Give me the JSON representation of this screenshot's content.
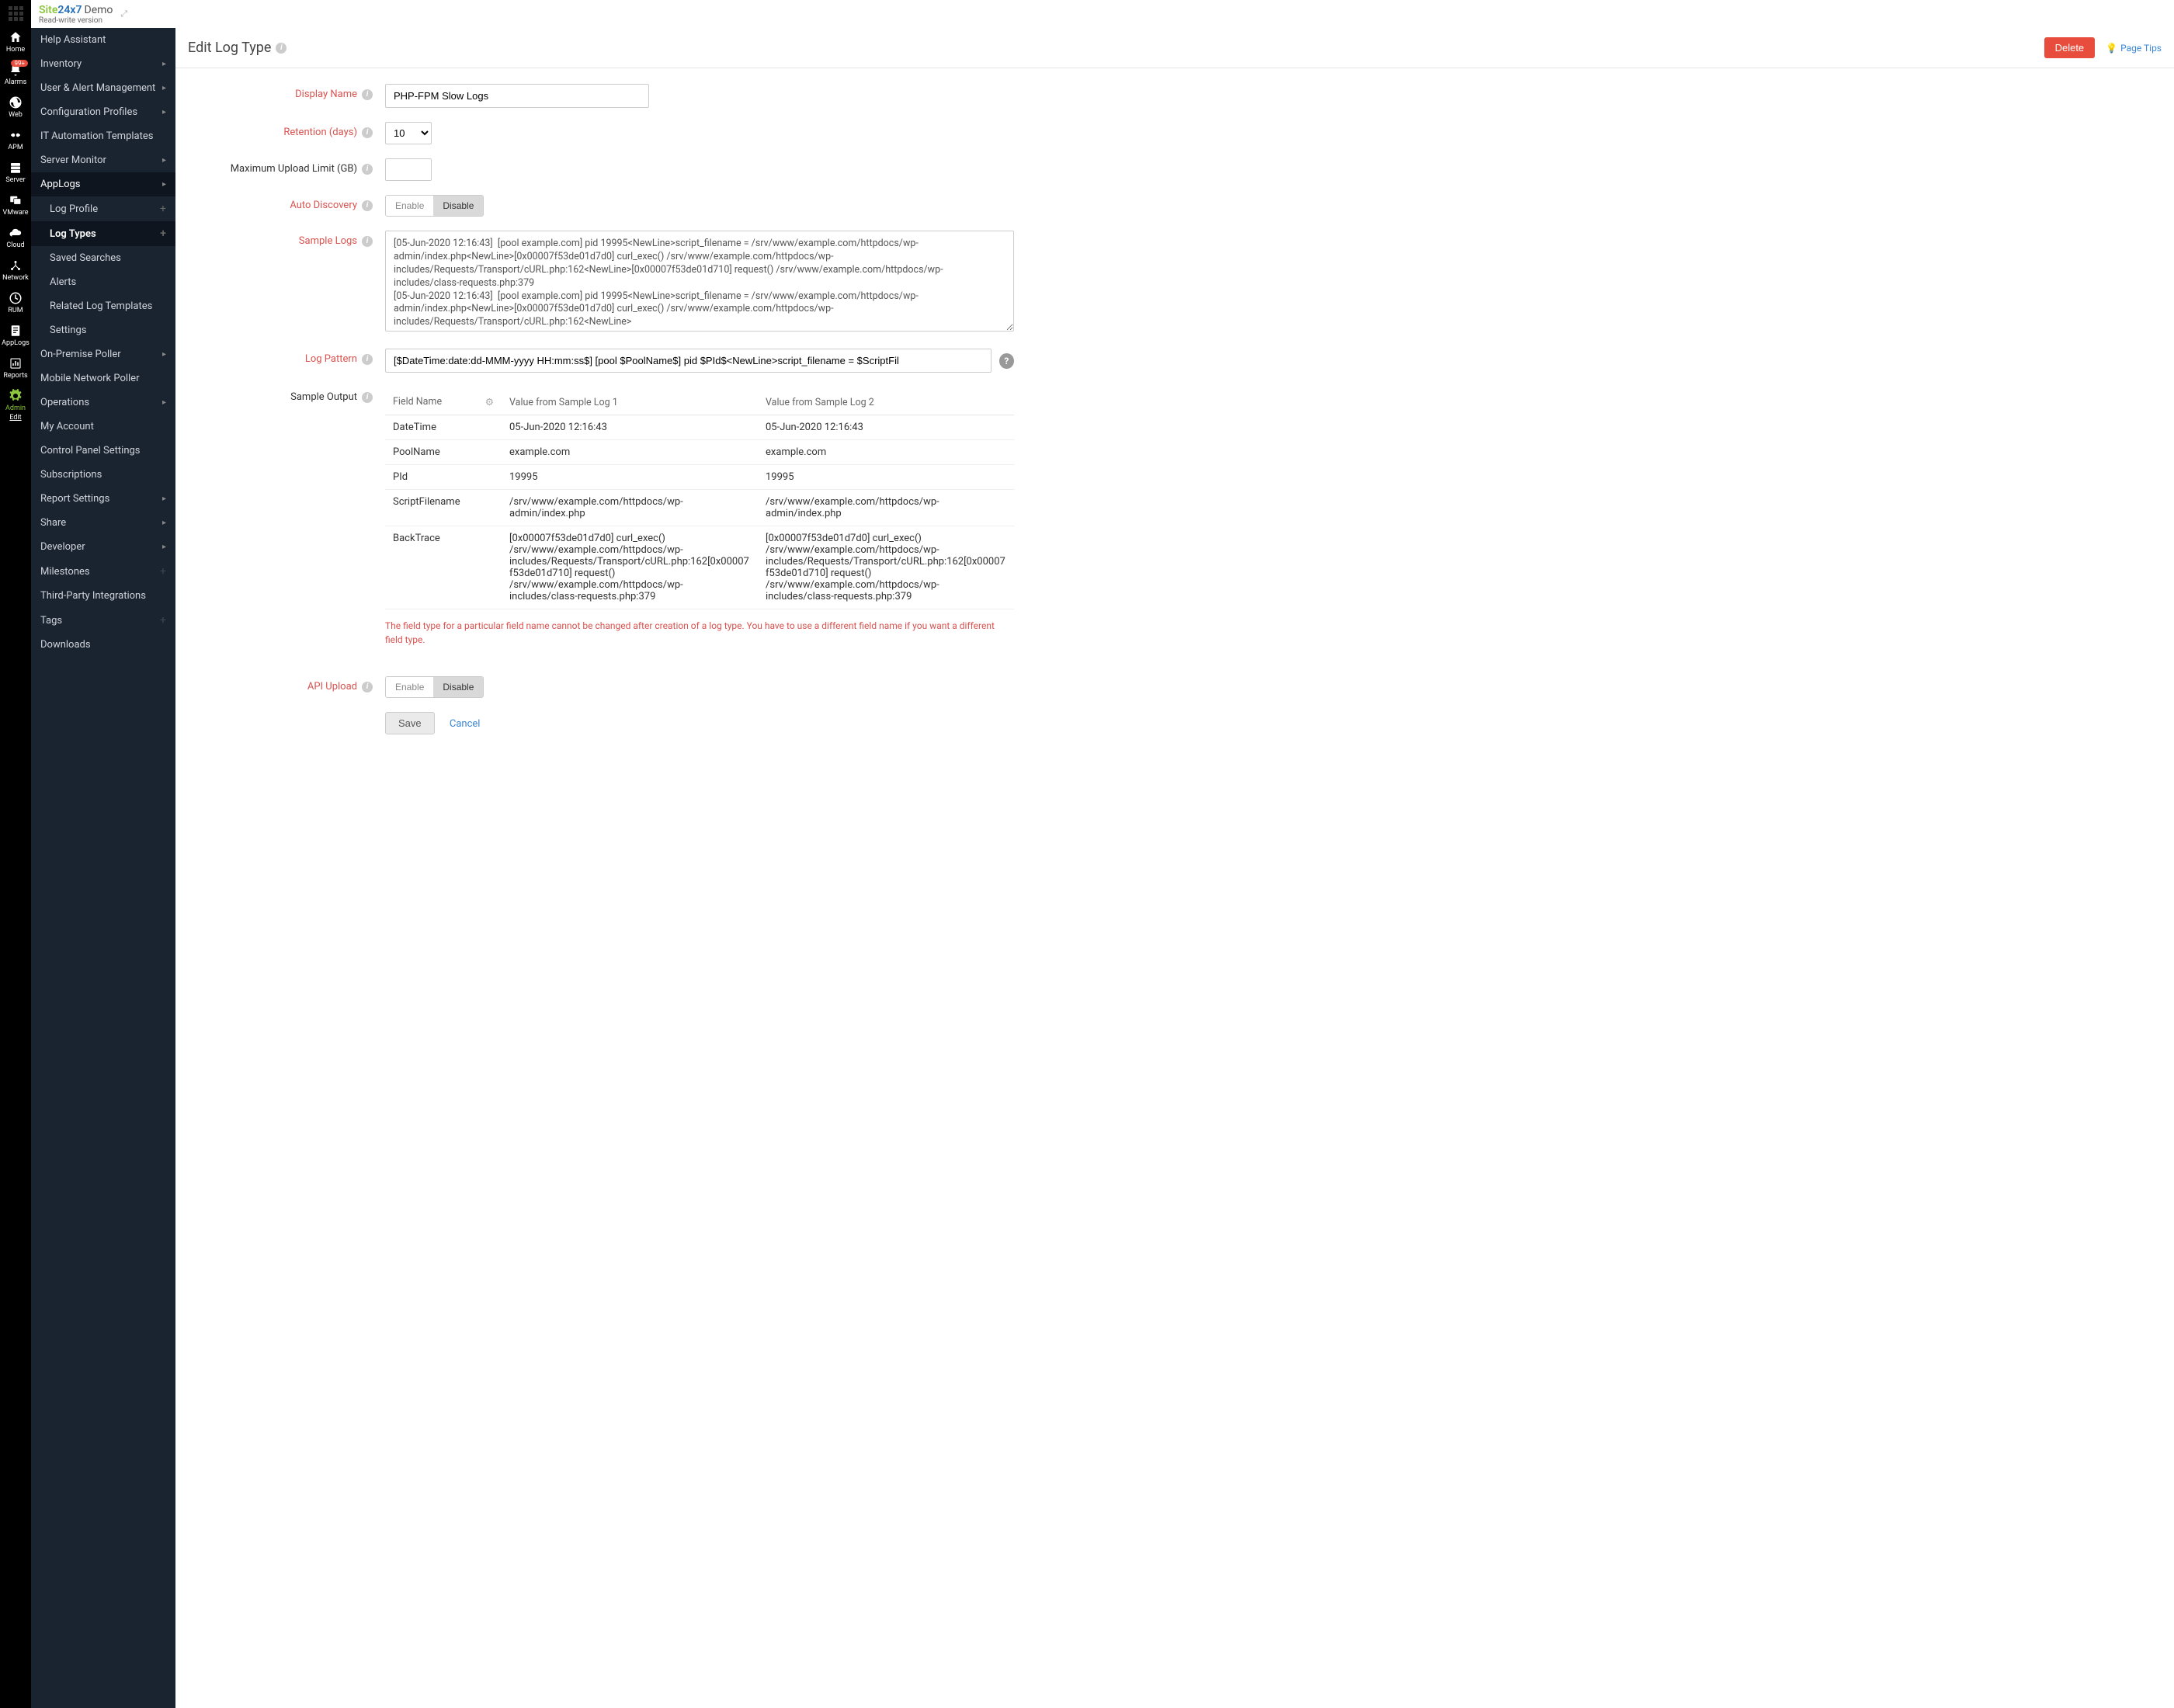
{
  "topbar": {
    "logo_site": "Site",
    "logo_247": "24x7",
    "logo_demo": "Demo",
    "logo_sub": "Read-write version"
  },
  "iconbar": [
    {
      "name": "Home"
    },
    {
      "name": "Alarms",
      "badge": "99+"
    },
    {
      "name": "Web"
    },
    {
      "name": "APM"
    },
    {
      "name": "Server"
    },
    {
      "name": "VMware"
    },
    {
      "name": "Cloud"
    },
    {
      "name": "Network"
    },
    {
      "name": "RUM"
    },
    {
      "name": "AppLogs"
    },
    {
      "name": "Reports"
    },
    {
      "name": "Admin",
      "active": true,
      "edit": "Edit"
    }
  ],
  "sidebar": {
    "items": [
      {
        "label": "Help Assistant"
      },
      {
        "label": "Inventory",
        "chev": true
      },
      {
        "label": "User & Alert Management",
        "chev": true
      },
      {
        "label": "Configuration Profiles",
        "chev": true
      },
      {
        "label": "IT Automation Templates"
      },
      {
        "label": "Server Monitor",
        "chev": true
      },
      {
        "label": "AppLogs",
        "chev": true,
        "section_active": true
      },
      {
        "label": "Log Profile",
        "sub": true,
        "plus": true
      },
      {
        "label": "Log Types",
        "sub": true,
        "plus": true,
        "active": true
      },
      {
        "label": "Saved Searches",
        "sub": true
      },
      {
        "label": "Alerts",
        "sub": true
      },
      {
        "label": "Related Log Templates",
        "sub": true
      },
      {
        "label": "Settings",
        "sub": true
      },
      {
        "label": "On-Premise Poller",
        "chev": true
      },
      {
        "label": "Mobile Network Poller"
      },
      {
        "label": "Operations",
        "chev": true
      },
      {
        "label": "My Account"
      },
      {
        "label": "Control Panel Settings"
      },
      {
        "label": "Subscriptions"
      },
      {
        "label": "Report Settings",
        "chev": true
      },
      {
        "label": "Share",
        "chev": true
      },
      {
        "label": "Developer",
        "chev": true
      },
      {
        "label": "Milestones",
        "plus_grey": true
      },
      {
        "label": "Third-Party Integrations"
      },
      {
        "label": "Tags",
        "plus_grey": true
      },
      {
        "label": "Downloads"
      }
    ]
  },
  "page": {
    "title": "Edit Log Type",
    "delete": "Delete",
    "tips": "Page Tips"
  },
  "form": {
    "display_name_label": "Display Name",
    "display_name_value": "PHP-FPM Slow Logs",
    "retention_label": "Retention (days)",
    "retention_value": "10",
    "max_upload_label": "Maximum Upload Limit (GB)",
    "max_upload_value": "",
    "auto_discovery_label": "Auto Discovery",
    "toggle_enable": "Enable",
    "toggle_disable": "Disable",
    "sample_logs_label": "Sample Logs",
    "sample_logs_value": "[05-Jun-2020 12:16:43]  [pool example.com] pid 19995<NewLine>script_filename = /srv/www/example.com/httpdocs/wp-admin/index.php<NewLine>[0x00007f53de01d7d0] curl_exec() /srv/www/example.com/httpdocs/wp-includes/Requests/Transport/cURL.php:162<NewLine>[0x00007f53de01d710] request() /srv/www/example.com/httpdocs/wp-includes/class-requests.php:379\n[05-Jun-2020 12:16:43]  [pool example.com] pid 19995<NewLine>script_filename = /srv/www/example.com/httpdocs/wp-admin/index.php<NewLine>[0x00007f53de01d7d0] curl_exec() /srv/www/example.com/httpdocs/wp-includes/Requests/Transport/cURL.php:162<NewLine>",
    "log_pattern_label": "Log Pattern",
    "log_pattern_value": "[$DateTime:date:dd-MMM-yyyy HH:mm:ss$] [pool $PoolName$] pid $PId$<NewLine>script_filename = $ScriptFil",
    "sample_output_label": "Sample Output",
    "table": {
      "col_field": "Field Name",
      "col_v1": "Value from Sample Log 1",
      "col_v2": "Value from Sample Log 2",
      "rows": [
        {
          "field": "DateTime",
          "v1": "05-Jun-2020 12:16:43",
          "v2": "05-Jun-2020 12:16:43"
        },
        {
          "field": "PoolName",
          "v1": "example.com",
          "v2": "example.com"
        },
        {
          "field": "PId",
          "v1": "19995",
          "v2": "19995"
        },
        {
          "field": "ScriptFilename",
          "v1": "/srv/www/example.com/httpdocs/wp-admin/index.php",
          "v2": "/srv/www/example.com/httpdocs/wp-admin/index.php"
        },
        {
          "field": "BackTrace",
          "v1": "[0x00007f53de01d7d0] curl_exec() /srv/www/example.com/httpdocs/wp-includes/Requests/Transport/cURL.php:162<NewLine>[0x00007f53de01d710] request() /srv/www/example.com/httpdocs/wp-includes/class-requests.php:379",
          "v2": "[0x00007f53de01d7d0] curl_exec() /srv/www/example.com/httpdocs/wp-includes/Requests/Transport/cURL.php:162<NewLine>[0x00007f53de01d710] request() /srv/www/example.com/httpdocs/wp-includes/class-requests.php:379"
        }
      ]
    },
    "note": "The field type for a particular field name cannot be changed after creation of a log type. You have to use a different field name if you want a different field type.",
    "api_upload_label": "API Upload",
    "save": "Save",
    "cancel": "Cancel"
  }
}
